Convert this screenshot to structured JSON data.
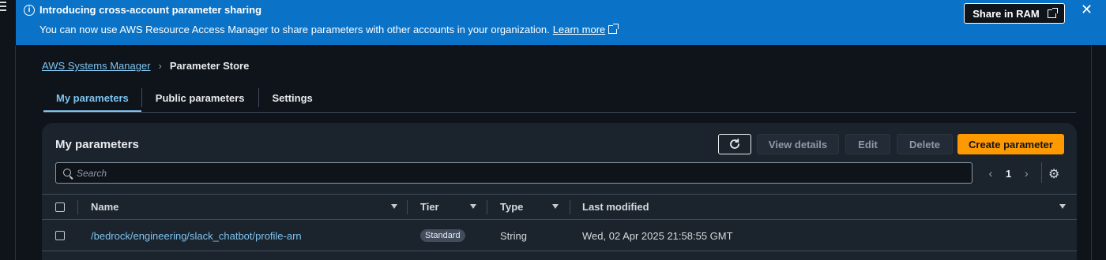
{
  "banner": {
    "title": "Introducing cross-account parameter sharing",
    "text": "You can now use AWS Resource Access Manager to share parameters with other accounts in your organization.",
    "link": "Learn more",
    "button": "Share in RAM",
    "info_icon": "info-icon",
    "close_icon": "close-icon",
    "color": "#0a73c8"
  },
  "breadcrumb": {
    "root": "AWS Systems Manager",
    "current": "Parameter Store"
  },
  "tabs": [
    {
      "label": "My parameters",
      "active": true
    },
    {
      "label": "Public parameters",
      "active": false
    },
    {
      "label": "Settings",
      "active": false
    }
  ],
  "panel": {
    "title": "My parameters",
    "actions": {
      "refresh_icon": "refresh-icon",
      "view": "View details",
      "edit": "Edit",
      "delete": "Delete",
      "create": "Create parameter"
    },
    "search": {
      "placeholder": "Search"
    },
    "pager": {
      "page": "1",
      "prev": "‹",
      "next": "›"
    },
    "settings_icon": "gear-icon"
  },
  "table": {
    "columns": [
      "Name",
      "Tier",
      "Type",
      "Last modified"
    ],
    "rows": [
      {
        "name": "/bedrock/engineering/slack_chatbot/profile-arn",
        "tier": "Standard",
        "type": "String",
        "last_modified": "Wed, 02 Apr 2025 21:58:55 GMT"
      }
    ]
  },
  "colors": {
    "accent": "#7ec3ee",
    "primary_button": "#ff9900",
    "background": "#0f141a",
    "panel": "#1b232d"
  }
}
